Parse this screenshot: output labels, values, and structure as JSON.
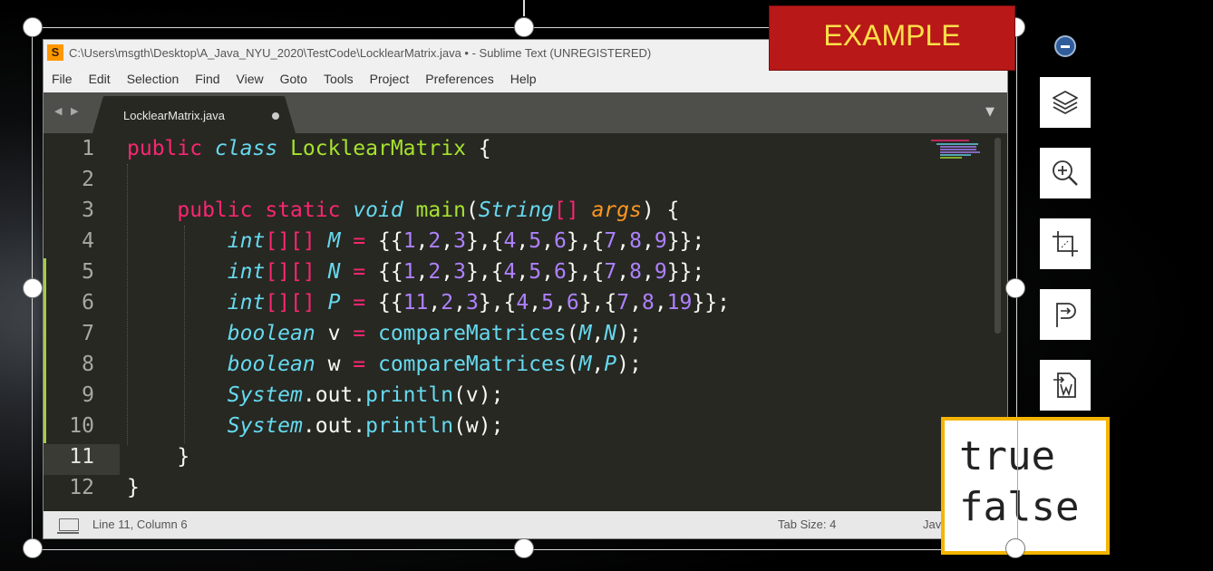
{
  "window": {
    "title": "C:\\Users\\msgth\\Desktop\\A_Java_NYU_2020\\TestCode\\LocklearMatrix.java • - Sublime Text (UNREGISTERED)",
    "app_icon": "sublime-icon"
  },
  "menu": [
    "File",
    "Edit",
    "Selection",
    "Find",
    "View",
    "Goto",
    "Tools",
    "Project",
    "Preferences",
    "Help"
  ],
  "tab": {
    "label": "LocklearMatrix.java",
    "modified_dot": "●",
    "nav": "◀ ▶",
    "dropdown": "▼"
  },
  "line_numbers": [
    "1",
    "2",
    "3",
    "4",
    "5",
    "6",
    "7",
    "8",
    "9",
    "10",
    "11",
    "12"
  ],
  "code_lines": [
    [
      {
        "t": "public",
        "c": "kw"
      },
      {
        "t": " "
      },
      {
        "t": "class",
        "c": "st"
      },
      {
        "t": " "
      },
      {
        "t": "LocklearMatrix",
        "c": "cn"
      },
      {
        "t": " {"
      }
    ],
    [],
    [
      {
        "t": "    "
      },
      {
        "t": "public",
        "c": "kw"
      },
      {
        "t": " "
      },
      {
        "t": "static",
        "c": "kw"
      },
      {
        "t": " "
      },
      {
        "t": "void",
        "c": "st"
      },
      {
        "t": " "
      },
      {
        "t": "main",
        "c": "cn"
      },
      {
        "t": "("
      },
      {
        "t": "String",
        "c": "st"
      },
      {
        "t": "[]",
        "c": "kw"
      },
      {
        "t": " "
      },
      {
        "t": "args",
        "c": "ar"
      },
      {
        "t": ") {"
      }
    ],
    [
      {
        "t": "        "
      },
      {
        "t": "int",
        "c": "st"
      },
      {
        "t": "[][]",
        "c": "kw"
      },
      {
        "t": " "
      },
      {
        "t": "M",
        "c": "st"
      },
      {
        "t": " "
      },
      {
        "t": "=",
        "c": "kw"
      },
      {
        "t": " {{"
      },
      {
        "t": "1",
        "c": "nu"
      },
      {
        "t": ","
      },
      {
        "t": "2",
        "c": "nu"
      },
      {
        "t": ","
      },
      {
        "t": "3",
        "c": "nu"
      },
      {
        "t": "},{"
      },
      {
        "t": "4",
        "c": "nu"
      },
      {
        "t": ","
      },
      {
        "t": "5",
        "c": "nu"
      },
      {
        "t": ","
      },
      {
        "t": "6",
        "c": "nu"
      },
      {
        "t": "},{"
      },
      {
        "t": "7",
        "c": "nu"
      },
      {
        "t": ","
      },
      {
        "t": "8",
        "c": "nu"
      },
      {
        "t": ","
      },
      {
        "t": "9",
        "c": "nu"
      },
      {
        "t": "}};"
      }
    ],
    [
      {
        "t": "        "
      },
      {
        "t": "int",
        "c": "st"
      },
      {
        "t": "[][]",
        "c": "kw"
      },
      {
        "t": " "
      },
      {
        "t": "N",
        "c": "st"
      },
      {
        "t": " "
      },
      {
        "t": "=",
        "c": "kw"
      },
      {
        "t": " {{"
      },
      {
        "t": "1",
        "c": "nu"
      },
      {
        "t": ","
      },
      {
        "t": "2",
        "c": "nu"
      },
      {
        "t": ","
      },
      {
        "t": "3",
        "c": "nu"
      },
      {
        "t": "},{"
      },
      {
        "t": "4",
        "c": "nu"
      },
      {
        "t": ","
      },
      {
        "t": "5",
        "c": "nu"
      },
      {
        "t": ","
      },
      {
        "t": "6",
        "c": "nu"
      },
      {
        "t": "},{"
      },
      {
        "t": "7",
        "c": "nu"
      },
      {
        "t": ","
      },
      {
        "t": "8",
        "c": "nu"
      },
      {
        "t": ","
      },
      {
        "t": "9",
        "c": "nu"
      },
      {
        "t": "}};"
      }
    ],
    [
      {
        "t": "        "
      },
      {
        "t": "int",
        "c": "st"
      },
      {
        "t": "[][]",
        "c": "kw"
      },
      {
        "t": " "
      },
      {
        "t": "P",
        "c": "st"
      },
      {
        "t": " "
      },
      {
        "t": "=",
        "c": "kw"
      },
      {
        "t": " {{"
      },
      {
        "t": "11",
        "c": "nu"
      },
      {
        "t": ","
      },
      {
        "t": "2",
        "c": "nu"
      },
      {
        "t": ","
      },
      {
        "t": "3",
        "c": "nu"
      },
      {
        "t": "},{"
      },
      {
        "t": "4",
        "c": "nu"
      },
      {
        "t": ","
      },
      {
        "t": "5",
        "c": "nu"
      },
      {
        "t": ","
      },
      {
        "t": "6",
        "c": "nu"
      },
      {
        "t": "},{"
      },
      {
        "t": "7",
        "c": "nu"
      },
      {
        "t": ","
      },
      {
        "t": "8",
        "c": "nu"
      },
      {
        "t": ","
      },
      {
        "t": "19",
        "c": "nu"
      },
      {
        "t": "}};"
      }
    ],
    [
      {
        "t": "        "
      },
      {
        "t": "boolean",
        "c": "st"
      },
      {
        "t": " v "
      },
      {
        "t": "=",
        "c": "kw"
      },
      {
        "t": " "
      },
      {
        "t": "compareMatrices",
        "c": "fn"
      },
      {
        "t": "("
      },
      {
        "t": "M",
        "c": "st"
      },
      {
        "t": ","
      },
      {
        "t": "N",
        "c": "st"
      },
      {
        "t": ");"
      }
    ],
    [
      {
        "t": "        "
      },
      {
        "t": "boolean",
        "c": "st"
      },
      {
        "t": " w "
      },
      {
        "t": "=",
        "c": "kw"
      },
      {
        "t": " "
      },
      {
        "t": "compareMatrices",
        "c": "fn"
      },
      {
        "t": "("
      },
      {
        "t": "M",
        "c": "st"
      },
      {
        "t": ","
      },
      {
        "t": "P",
        "c": "st"
      },
      {
        "t": ");"
      }
    ],
    [
      {
        "t": "        "
      },
      {
        "t": "System",
        "c": "st"
      },
      {
        "t": ".out."
      },
      {
        "t": "println",
        "c": "fn"
      },
      {
        "t": "(v);"
      }
    ],
    [
      {
        "t": "        "
      },
      {
        "t": "System",
        "c": "st"
      },
      {
        "t": ".out."
      },
      {
        "t": "println",
        "c": "fn"
      },
      {
        "t": "(w);"
      }
    ],
    [
      {
        "t": "    }"
      }
    ],
    [
      {
        "t": "}"
      }
    ]
  ],
  "current_line": 11,
  "modified_lines": [
    5,
    6,
    7,
    8,
    9,
    10
  ],
  "status": {
    "position": "Line 11, Column 6",
    "tab_size": "Tab Size: 4",
    "syntax": "Jav"
  },
  "overlay": {
    "label": "EXAMPLE"
  },
  "side_toolbar": [
    "minus-icon",
    "layers-icon",
    "zoom-in-icon",
    "crop-icon",
    "convert-icon",
    "export-word-icon"
  ],
  "output": [
    "true",
    "false"
  ],
  "colors": {
    "keyword": "#f92672",
    "storage": "#66d9ef",
    "class": "#a6e22e",
    "number": "#ae81ff",
    "param": "#fd971f",
    "accent": "#f5b400",
    "banner": "#b81818"
  }
}
